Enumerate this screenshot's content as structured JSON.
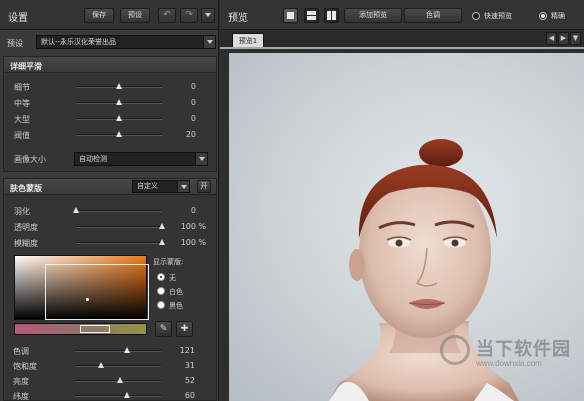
{
  "left_panel": {
    "title": "设置",
    "buttons": {
      "save": "保存",
      "preset": "预设",
      "undo_icon": "↶",
      "redo_icon": "↷"
    },
    "preset": {
      "label": "预设",
      "value": "默认--永乐汉化荣誉出品"
    },
    "detail_smoothing": {
      "title": "详细平滑",
      "sliders": [
        {
          "name": "细节",
          "value": "0",
          "level": 0.5
        },
        {
          "name": "中等",
          "value": "0",
          "level": 0.5
        },
        {
          "name": "大型",
          "value": "0",
          "level": 0.5
        },
        {
          "name": "阀值",
          "value": "20",
          "level": 0.5
        }
      ],
      "image_size": {
        "label": "画像大小",
        "value": "自动检测"
      }
    },
    "skin_mask": {
      "title": "肤色蒙版",
      "mode": "自定义",
      "toggle": "开",
      "sliders": [
        {
          "name": "羽化",
          "value": "0",
          "unit": "",
          "level": 0.0
        },
        {
          "name": "透明度",
          "value": "100",
          "unit": "%",
          "level": 1.0
        },
        {
          "name": "模糊度",
          "value": "100",
          "unit": "%",
          "level": 1.0
        }
      ],
      "display_mask": {
        "label": "显示蒙版:",
        "options": [
          {
            "label": "无",
            "selected": true
          },
          {
            "label": "白色",
            "selected": false
          },
          {
            "label": "黑色",
            "selected": false
          }
        ]
      },
      "tools": {
        "eyedropper_icon": "✎",
        "eyedropper_plus_icon": "✚"
      },
      "color_sliders": [
        {
          "name": "色调",
          "value": "121",
          "level": 0.6
        },
        {
          "name": "饱和度",
          "value": "31",
          "level": 0.3
        },
        {
          "name": "亮度",
          "value": "52",
          "level": 0.52
        },
        {
          "name": "纬度",
          "value": "60",
          "level": 0.6
        }
      ]
    }
  },
  "right_panel": {
    "title": "预览",
    "add_preview": "添加预览",
    "color": "色调",
    "modes": [
      {
        "label": "快速预览",
        "selected": false
      },
      {
        "label": "精确",
        "selected": true
      }
    ],
    "tab": "预览1",
    "nav_icons": {
      "prev": "◀",
      "next": "▶",
      "menu": "▼"
    }
  },
  "watermark": {
    "brand": "当下软件园",
    "url": "www.downxia.com"
  }
}
